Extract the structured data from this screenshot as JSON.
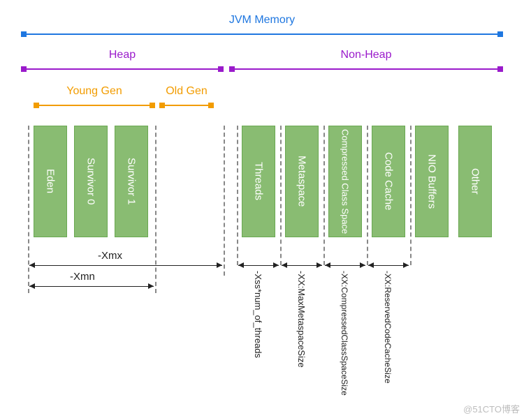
{
  "title": "JVM Memory",
  "top_groups": {
    "heap": "Heap",
    "nonheap": "Non-Heap"
  },
  "heap_gens": {
    "young": "Young Gen",
    "old": "Old Gen"
  },
  "heap_boxes": {
    "eden": "Eden",
    "s0": "Survivor 0",
    "s1": "Survivor 1"
  },
  "nonheap_boxes": {
    "threads": "Threads",
    "metaspace": "Metaspace",
    "ccs": "Compressed Class Space",
    "codecache": "Code Cache",
    "nio": "NIO Buffers",
    "other": "Other"
  },
  "heap_flags": {
    "xmx": "-Xmx",
    "xmn": "-Xmn"
  },
  "nonheap_flags": {
    "threads": "-Xss*num_of_threads",
    "metaspace": "-XX:MaxMetaspaceSize",
    "ccs": "-XX:CompressedClassSpaceSize",
    "codecache": "-XX:ReservedCodeCacheSize"
  },
  "colors": {
    "jvm": "#1f77e0",
    "heap_group": "#9a1acb",
    "gen_group": "#f29c00",
    "box": "#89bc72"
  },
  "watermark": "@51CTO博客"
}
